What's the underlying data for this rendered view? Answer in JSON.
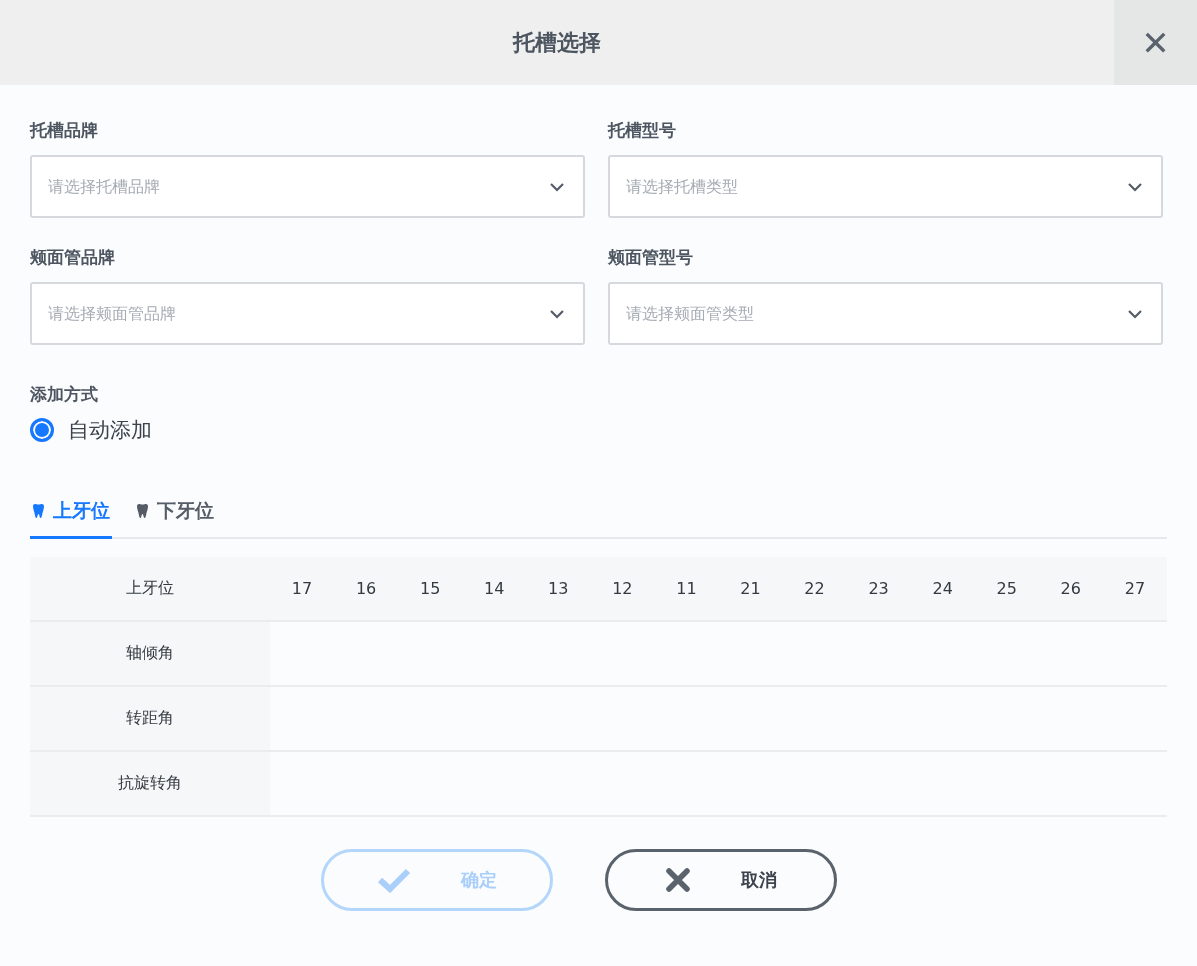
{
  "dialog": {
    "title": "托槽选择",
    "close_icon": "✕"
  },
  "fields": [
    {
      "label": "托槽品牌",
      "placeholder": "请选择托槽品牌"
    },
    {
      "label": "托槽型号",
      "placeholder": "请选择托槽类型"
    },
    {
      "label": "颊面管品牌",
      "placeholder": "请选择颊面管品牌"
    },
    {
      "label": "颊面管型号",
      "placeholder": "请选择颊面管类型"
    }
  ],
  "add_method": {
    "label": "添加方式",
    "options": [
      {
        "label": "自动添加",
        "selected": true
      }
    ]
  },
  "tabs": [
    {
      "label": "上牙位",
      "selected": true
    },
    {
      "label": "下牙位",
      "selected": false
    }
  ],
  "table": {
    "corner": "上牙位",
    "columns": [
      "17",
      "16",
      "15",
      "14",
      "13",
      "12",
      "11",
      "21",
      "22",
      "23",
      "24",
      "25",
      "26",
      "27"
    ],
    "rows": [
      {
        "label": "轴倾角"
      },
      {
        "label": "转距角"
      },
      {
        "label": "抗旋转角"
      }
    ]
  },
  "buttons": [
    {
      "kind": "confirm",
      "label": "确定",
      "disabled": true
    },
    {
      "kind": "cancel",
      "label": "取消",
      "disabled": false
    }
  ]
}
